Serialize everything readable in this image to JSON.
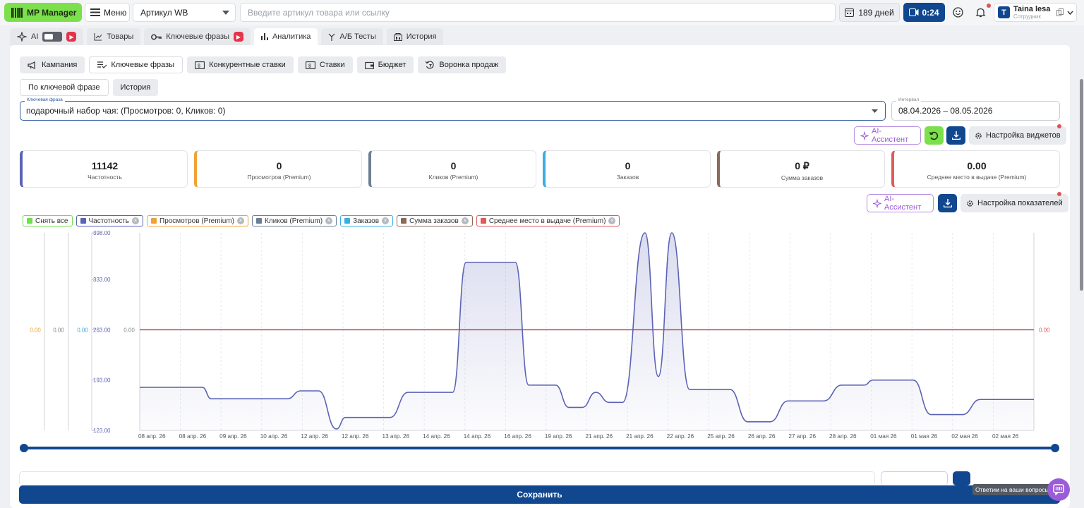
{
  "topbar": {
    "logo": "MP Manager",
    "menu": "Меню",
    "article_select": "Артикул WB",
    "search_placeholder": "Введите артикул товара или ссылку",
    "days": "189 дней",
    "timer": "0:24",
    "user_initial": "T",
    "user_name": "Taina lesa",
    "user_role": "Сотрудник"
  },
  "tabs": [
    {
      "label": "AI"
    },
    {
      "label": "Товары"
    },
    {
      "label": "Ключевые фразы"
    },
    {
      "label": "Аналитика"
    },
    {
      "label": "А/Б Тесты"
    },
    {
      "label": "История"
    }
  ],
  "subtabs": [
    "Кампания",
    "Ключевые фразы",
    "Конкурентные ставки",
    "Ставки",
    "Бюджет",
    "Воронка продаж"
  ],
  "viewtabs": [
    "По ключевой фразе",
    "История"
  ],
  "keyword": {
    "label": "Ключевая фраза",
    "value": "подарочный набор чая: (Просмотров: 0, Кликов: 0)"
  },
  "interval": {
    "label": "Интервал",
    "value": "08.04.2026 – 08.05.2026"
  },
  "ai_assistant": "AI-Ассистент",
  "widget_settings": "Настройка виджетов",
  "metric_settings": "Настройка показателей",
  "cards": [
    {
      "value": "11142",
      "label": "Частотность",
      "color": "#5b63b5"
    },
    {
      "value": "0",
      "label": "Просмотров (Premium)",
      "color": "#f0a23a"
    },
    {
      "value": "0",
      "label": "Кликов (Premium)",
      "color": "#6b7f94"
    },
    {
      "value": "0",
      "label": "Заказов",
      "color": "#3aaee0"
    },
    {
      "value": "0 ₽",
      "label": "Сумма заказов",
      "color": "#8a6a58"
    },
    {
      "value": "0.00",
      "label": "Среднее место в выдаче (Premium)",
      "color": "#e05a5a"
    }
  ],
  "legend": [
    {
      "label": "Снять все",
      "color": "#6de04b",
      "x": false
    },
    {
      "label": "Частотность",
      "color": "#5b63b5",
      "x": true
    },
    {
      "label": "Просмотров (Premium)",
      "color": "#f0a23a",
      "x": true
    },
    {
      "label": "Кликов (Premium)",
      "color": "#6b7f94",
      "x": true
    },
    {
      "label": "Заказов",
      "color": "#3aaee0",
      "x": true
    },
    {
      "label": "Сумма заказов",
      "color": "#8a6a58",
      "x": true
    },
    {
      "label": "Среднее место в выдаче (Premium)",
      "color": "#e05a5a",
      "x": true
    }
  ],
  "chart_data": {
    "type": "line",
    "x": [
      "08 апр. 26",
      "08 апр. 26",
      "09 апр. 26",
      "10 апр. 26",
      "12 апр. 26",
      "12 апр. 26",
      "13 апр. 26",
      "14 апр. 26",
      "14 апр. 26",
      "16 апр. 26",
      "19 апр. 26",
      "21 апр. 26",
      "21 апр. 26",
      "22 апр. 26",
      "25 апр. 26",
      "26 апр. 26",
      "27 апр. 26",
      "28 апр. 26",
      "01 мая 26",
      "01 мая 26",
      "02 мая 26",
      "02 мая 26"
    ],
    "y_ticks": [
      "398.00",
      "333.00",
      "263.00",
      "193.00",
      "123.00"
    ],
    "other_axes": [
      {
        "label": "0.00",
        "color": "#f0a23a"
      },
      {
        "label": "0.00",
        "color": "#888888"
      },
      {
        "label": "0.00",
        "color": "#3aaee0"
      },
      {
        "label": "0.00",
        "color": "#888888"
      },
      {
        "label": "0.00",
        "color": "#e05a5a"
      }
    ],
    "ylim": [
      123,
      398
    ],
    "series": [
      {
        "name": "Частотность",
        "color": "#5b63b5",
        "points": [
          [
            0,
            183
          ],
          [
            1.4,
            183
          ],
          [
            1.6,
            167
          ],
          [
            3.3,
            167
          ],
          [
            3.6,
            178
          ],
          [
            4.0,
            178
          ],
          [
            4.4,
            125
          ],
          [
            4.6,
            141
          ],
          [
            5.6,
            141
          ],
          [
            6.0,
            176
          ],
          [
            7.0,
            176
          ],
          [
            7.3,
            357
          ],
          [
            8.4,
            357
          ],
          [
            8.7,
            186
          ],
          [
            9.3,
            186
          ],
          [
            9.6,
            155
          ],
          [
            9.9,
            155
          ],
          [
            10.2,
            176
          ],
          [
            10.5,
            162
          ],
          [
            10.8,
            162
          ],
          [
            11.3,
            398
          ],
          [
            11.6,
            198
          ],
          [
            11.9,
            398
          ],
          [
            12.3,
            180
          ],
          [
            13.2,
            180
          ],
          [
            13.6,
            135
          ],
          [
            14.1,
            135
          ],
          [
            14.5,
            164
          ],
          [
            15.3,
            164
          ],
          [
            15.7,
            186
          ],
          [
            16.2,
            186
          ],
          [
            16.4,
            193
          ],
          [
            17.3,
            193
          ],
          [
            17.7,
            145
          ],
          [
            18.4,
            145
          ],
          [
            18.8,
            166
          ],
          [
            20.0,
            166
          ]
        ]
      },
      {
        "name": "Среднее место в выдаче (Premium)",
        "color": "#a33a3a",
        "constant": 0
      }
    ]
  },
  "save": "Сохранить",
  "help": "Ответим на ваши вопросы"
}
